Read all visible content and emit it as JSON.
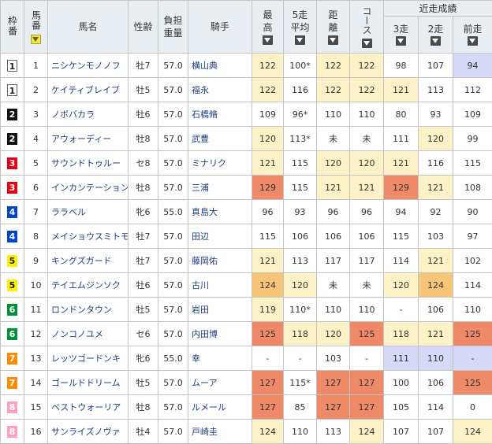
{
  "headers": {
    "waku": "枠番",
    "umaban": "馬番",
    "horse": "馬名",
    "sexage": "性齢",
    "weight": "負担重量",
    "jockey": "騎手",
    "best": "最高",
    "avg5": "5走平均",
    "distance": "距離",
    "course": "コース",
    "recent": "近走成績",
    "r3": "3走",
    "r2": "2走",
    "r1": "前走"
  },
  "icons": {
    "sort": "sort-down-icon"
  },
  "colors": {
    "header_bg": "#e9eef2",
    "tier1": "#fdf1c8",
    "tier2": "#f6c578",
    "tier3": "#ef8a68",
    "lavender": "#d6d9f7"
  },
  "rows": [
    {
      "waku": "1",
      "num": "1",
      "name": "ニシケンモノノフ",
      "sexage": "牡7",
      "weight": "57.0",
      "jockey": "横山典",
      "best": "122",
      "avg": "100*",
      "dist": "122",
      "course": "122",
      "r3": "98",
      "r2": "107",
      "r1": "94"
    },
    {
      "waku": "1",
      "num": "2",
      "name": "ケイティブレイブ",
      "sexage": "牡5",
      "weight": "57.0",
      "jockey": "福永",
      "best": "122",
      "avg": "116",
      "dist": "122",
      "course": "122",
      "r3": "121",
      "r2": "113",
      "r1": "112"
    },
    {
      "waku": "2",
      "num": "3",
      "name": "ノボバカラ",
      "sexage": "牡6",
      "weight": "57.0",
      "jockey": "石橋脩",
      "best": "109",
      "avg": "96*",
      "dist": "110",
      "course": "110",
      "r3": "80",
      "r2": "93",
      "r1": "109"
    },
    {
      "waku": "2",
      "num": "4",
      "name": "アウォーディー",
      "sexage": "牡8",
      "weight": "57.0",
      "jockey": "武豊",
      "best": "120",
      "avg": "113*",
      "dist": "未",
      "course": "未",
      "r3": "111",
      "r2": "120",
      "r1": "99"
    },
    {
      "waku": "3",
      "num": "5",
      "name": "サウンドトゥルー",
      "sexage": "セ8",
      "weight": "57.0",
      "jockey": "ミナリク",
      "best": "121",
      "avg": "115",
      "dist": "120",
      "course": "120",
      "r3": "121",
      "r2": "116",
      "r1": "115"
    },
    {
      "waku": "3",
      "num": "6",
      "name": "インカンテーション",
      "sexage": "牡8",
      "weight": "57.0",
      "jockey": "三浦",
      "best": "129",
      "avg": "115",
      "dist": "121",
      "course": "121",
      "r3": "129",
      "r2": "121",
      "r1": "108"
    },
    {
      "waku": "4",
      "num": "7",
      "name": "ララベル",
      "sexage": "牝6",
      "weight": "55.0",
      "jockey": "真島大",
      "best": "96",
      "avg": "93",
      "dist": "96",
      "course": "96",
      "r3": "94",
      "r2": "92",
      "r1": "90"
    },
    {
      "waku": "4",
      "num": "8",
      "name": "メイショウスミトモ",
      "sexage": "牡7",
      "weight": "57.0",
      "jockey": "田辺",
      "best": "115",
      "avg": "106",
      "dist": "106",
      "course": "106",
      "r3": "115",
      "r2": "103",
      "r1": "97"
    },
    {
      "waku": "5",
      "num": "9",
      "name": "キングズガード",
      "sexage": "牡7",
      "weight": "57.0",
      "jockey": "藤岡佑",
      "best": "121",
      "avg": "113",
      "dist": "117",
      "course": "117",
      "r3": "114",
      "r2": "121",
      "r1": "102"
    },
    {
      "waku": "5",
      "num": "10",
      "name": "テイエムジンソク",
      "sexage": "牡6",
      "weight": "57.0",
      "jockey": "古川",
      "best": "124",
      "avg": "120",
      "dist": "未",
      "course": "未",
      "r3": "120",
      "r2": "124",
      "r1": "114"
    },
    {
      "waku": "6",
      "num": "11",
      "name": "ロンドンタウン",
      "sexage": "牡5",
      "weight": "57.0",
      "jockey": "岩田",
      "best": "119",
      "avg": "110*",
      "dist": "110",
      "course": "110",
      "r3": "-",
      "r2": "106",
      "r1": "110"
    },
    {
      "waku": "6",
      "num": "12",
      "name": "ノンコノユメ",
      "sexage": "セ6",
      "weight": "57.0",
      "jockey": "内田博",
      "best": "125",
      "avg": "118",
      "dist": "120",
      "course": "125",
      "r3": "118",
      "r2": "121",
      "r1": "125"
    },
    {
      "waku": "7",
      "num": "13",
      "name": "レッツゴードンキ",
      "sexage": "牝6",
      "weight": "55.0",
      "jockey": "幸",
      "best": "-",
      "avg": "-",
      "dist": "103",
      "course": "-",
      "r3": "111",
      "r2": "110",
      "r1": "-"
    },
    {
      "waku": "7",
      "num": "14",
      "name": "ゴールドドリーム",
      "sexage": "牡5",
      "weight": "57.0",
      "jockey": "ムーア",
      "best": "127",
      "avg": "115*",
      "dist": "127",
      "course": "127",
      "r3": "100",
      "r2": "106",
      "r1": "125"
    },
    {
      "waku": "8",
      "num": "15",
      "name": "ベストウォーリア",
      "sexage": "牡8",
      "weight": "57.0",
      "jockey": "ルメール",
      "best": "127",
      "avg": "85",
      "dist": "127",
      "course": "127",
      "r3": "105",
      "r2": "114",
      "r1": "0"
    },
    {
      "waku": "8",
      "num": "16",
      "name": "サンライズノヴァ",
      "sexage": "牡4",
      "weight": "57.0",
      "jockey": "戸崎圭",
      "best": "124",
      "avg": "110",
      "dist": "113",
      "course": "124",
      "r3": "107",
      "r2": "107",
      "r1": "124"
    }
  ]
}
